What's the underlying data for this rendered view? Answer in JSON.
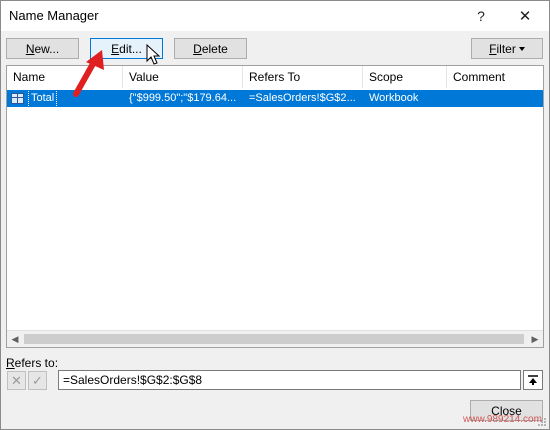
{
  "window": {
    "title": "Name Manager",
    "help_label": "?",
    "close_label": "✕"
  },
  "toolbar": {
    "new": {
      "underline": "N",
      "rest": "ew..."
    },
    "edit": {
      "underline": "E",
      "rest": "dit..."
    },
    "delete": {
      "underline": "D",
      "rest": "elete"
    },
    "filter": {
      "underline": "F",
      "rest": "ilter"
    }
  },
  "columns": [
    "Name",
    "Value",
    "Refers To",
    "Scope",
    "Comment"
  ],
  "rows": [
    {
      "name": "Total",
      "value": "{\"$999.50\";\"$179.64...",
      "refers_to": "=SalesOrders!$G$2...",
      "scope": "Workbook",
      "comment": "",
      "selected": true
    }
  ],
  "scrollbar": {
    "left_arrow": "◀",
    "right_arrow": "▶"
  },
  "refers_to": {
    "label_underline": "R",
    "label_rest": "efers to:",
    "value": "=SalesOrders!$G$2:$G$8",
    "cancel_icon": "✕",
    "confirm_icon": "✓"
  },
  "footer": {
    "close_label": "Close",
    "watermark": "www.989214.com"
  },
  "colors": {
    "selection": "#0078d7",
    "annotation_arrow": "#e02020"
  },
  "icons": {
    "table": "table-icon",
    "collapse": "collapse-dialog-icon",
    "cursor": "mouse-cursor-icon",
    "annotation": "red-arrow-icon"
  }
}
